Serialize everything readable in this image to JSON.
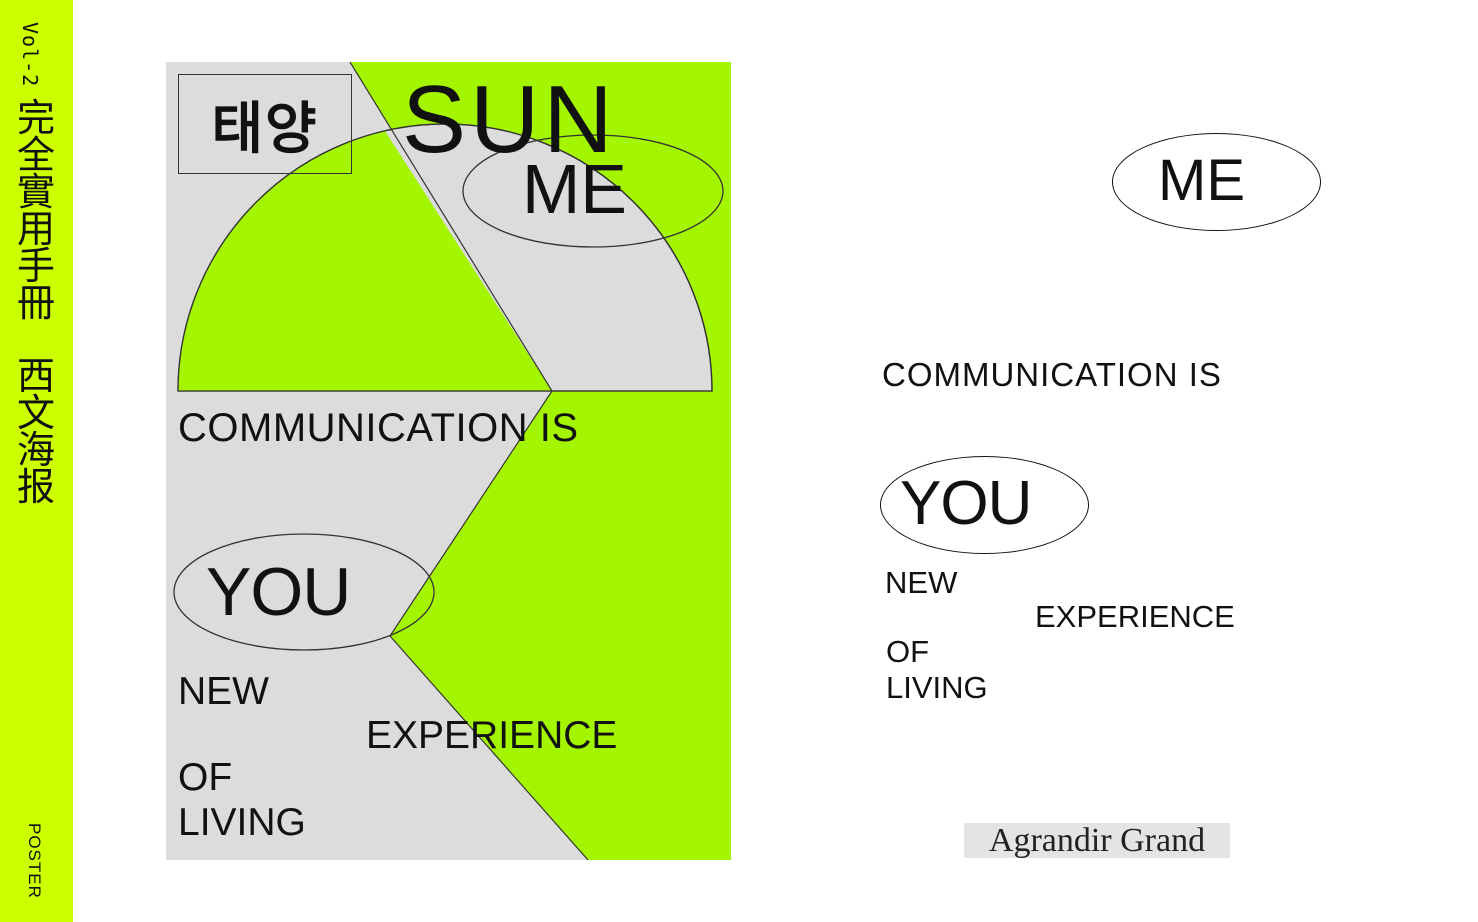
{
  "sidebar": {
    "volume": "Vol-2",
    "title_chars": [
      "完",
      "全",
      "實",
      "用",
      "手",
      "冊"
    ],
    "subtitle_chars": [
      "西",
      "文",
      "海",
      "报"
    ],
    "bottom_label": "POSTER",
    "color": "#ccff00"
  },
  "poster": {
    "korean": "태양",
    "sun": "SUN",
    "me": "ME",
    "communication": "COMMUNICATION IS",
    "you": "YOU",
    "new": "NEW",
    "experience": "EXPERIENCE",
    "of": "OF",
    "living": "LIVING",
    "green": "#a4f500",
    "gray": "#dcdcdc"
  },
  "specimen": {
    "me": "ME",
    "communication": "COMMUNICATION IS",
    "you": "YOU",
    "new": "NEW",
    "experience": "EXPERIENCE",
    "of": "OF",
    "living": "LIVING",
    "font_name": "Agrandir Grand"
  }
}
